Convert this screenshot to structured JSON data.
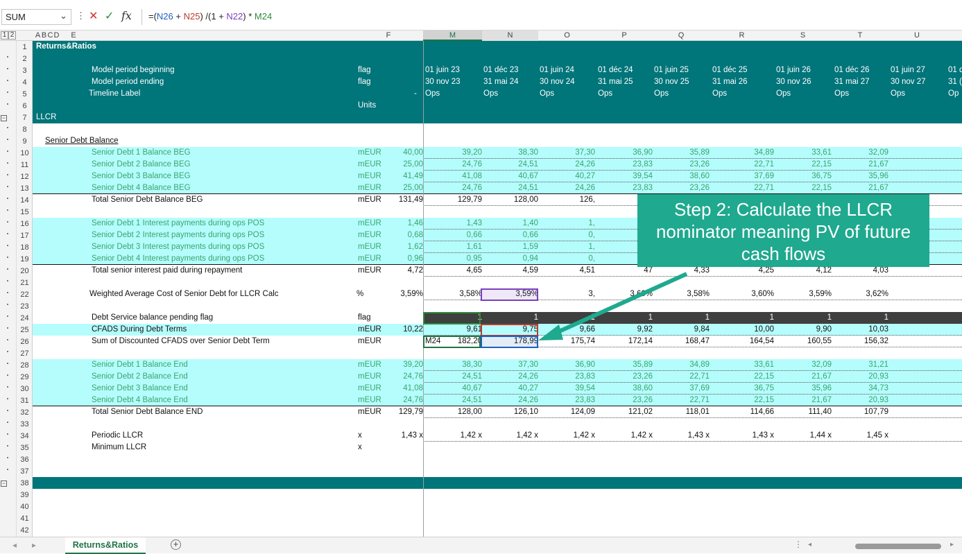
{
  "formula_bar": {
    "name_box": "SUM",
    "dots": "⋮",
    "cancel_icon": "✕",
    "enter_icon": "✓",
    "fx_label": "fx",
    "formula_parts": [
      {
        "t": "=(",
        "c": "#222"
      },
      {
        "t": "N26",
        "c": "#1f5fbf"
      },
      {
        "t": " + ",
        "c": "#222"
      },
      {
        "t": "N25",
        "c": "#c0392b"
      },
      {
        "t": ") /(1 + ",
        "c": "#222"
      },
      {
        "t": "N22",
        "c": "#7a3fbf"
      },
      {
        "t": ") * ",
        "c": "#222"
      },
      {
        "t": "M24",
        "c": "#2e8b3e"
      }
    ]
  },
  "outline_levels": [
    "1",
    "2"
  ],
  "columns": [
    "A",
    "B",
    "C",
    "D",
    "E",
    "F",
    "M",
    "N",
    "O",
    "P",
    "Q",
    "R",
    "S",
    "T",
    "U"
  ],
  "sheet_title": "Returns&Ratios",
  "header": {
    "periods_begin": [
      "01 juin 23",
      "01 déc 23",
      "01 juin 24",
      "01 déc 24",
      "01 juin 25",
      "01 déc 25",
      "01 juin 26",
      "01 déc 26",
      "01 juin 27",
      "01 d"
    ],
    "periods_end": [
      "30 nov 23",
      "31 mai 24",
      "30 nov 24",
      "31 mai 25",
      "30 nov 25",
      "31 mai 26",
      "30 nov 26",
      "31 mai 27",
      "30 nov 27",
      "31 ("
    ],
    "timeline": [
      "Ops",
      "Ops",
      "Ops",
      "Ops",
      "Ops",
      "Ops",
      "Ops",
      "Ops",
      "Ops",
      "Op"
    ]
  },
  "rows": [
    {
      "r": "1",
      "label": "Returns&Ratios",
      "bg": "teal",
      "bold": true,
      "indent": "a"
    },
    {
      "r": "2",
      "bg": "teal"
    },
    {
      "r": "3",
      "label": "Model period beginning",
      "unit": "flag",
      "bg": "teal",
      "hdr": "periods_begin"
    },
    {
      "r": "4",
      "label": "Model period ending",
      "unit": "flag",
      "bg": "teal",
      "hdr": "periods_end"
    },
    {
      "r": "5",
      "label": "Timeline Label",
      "unit": "-",
      "bg": "teal",
      "hdr": "timeline"
    },
    {
      "r": "6",
      "unit": "Units",
      "bg": "teal"
    },
    {
      "r": "7",
      "label": "LLCR",
      "bg": "teal",
      "indent": "a"
    },
    {
      "r": "8"
    },
    {
      "r": "9",
      "label": "Senior Debt Balance",
      "underline": true,
      "indent": "b"
    },
    {
      "r": "10",
      "label": "Senior Debt 1 Balance BEG",
      "unit": "mEUR",
      "bg": "cyan",
      "green": true,
      "v": [
        "40,00",
        "39,20",
        "38,30",
        "37,30",
        "36,90",
        "35,89",
        "34,89",
        "33,61",
        "32,09"
      ]
    },
    {
      "r": "11",
      "label": "Senior Debt 2 Balance BEG",
      "unit": "mEUR",
      "bg": "cyan",
      "green": true,
      "v": [
        "25,00",
        "24,76",
        "24,51",
        "24,26",
        "23,83",
        "23,26",
        "22,71",
        "22,15",
        "21,67"
      ]
    },
    {
      "r": "12",
      "label": "Senior Debt 3 Balance BEG",
      "unit": "mEUR",
      "bg": "cyan",
      "green": true,
      "v": [
        "41,49",
        "41,08",
        "40,67",
        "40,27",
        "39,54",
        "38,60",
        "37,69",
        "36,75",
        "35,96"
      ]
    },
    {
      "r": "13",
      "label": "Senior Debt 4 Balance BEG",
      "unit": "mEUR",
      "bg": "cyan",
      "green": true,
      "v": [
        "25,00",
        "24,76",
        "24,51",
        "24,26",
        "23,83",
        "23,26",
        "22,71",
        "22,15",
        "21,67"
      ]
    },
    {
      "r": "14",
      "label": "Total Senior Debt Balance BEG",
      "unit": "mEUR",
      "topline": true,
      "v": [
        "131,49",
        "129,79",
        "128,00",
        "126,",
        "",
        "",
        "",
        "",
        "40"
      ]
    },
    {
      "r": "15"
    },
    {
      "r": "16",
      "label": "Senior Debt 1 Interest payments during ops POS",
      "unit": "mEUR",
      "bg": "cyan",
      "green": true,
      "v": [
        "1,46",
        "1,43",
        "1,40",
        "1,",
        "",
        "",
        "",
        "",
        "17"
      ]
    },
    {
      "r": "17",
      "label": "Senior Debt 2 Interest payments during ops POS",
      "unit": "mEUR",
      "bg": "cyan",
      "green": true,
      "v": [
        "0,68",
        "0,66",
        "0,66",
        "0,",
        "",
        "",
        "",
        "",
        "62"
      ]
    },
    {
      "r": "18",
      "label": "Senior Debt 3 Interest payments during ops POS",
      "unit": "mEUR",
      "bg": "cyan",
      "green": true,
      "v": [
        "1,62",
        "1,61",
        "1,59",
        "1,",
        "",
        "",
        "",
        "",
        "41"
      ]
    },
    {
      "r": "19",
      "label": "Senior Debt 4 Interest payments during ops POS",
      "unit": "mEUR",
      "bg": "cyan",
      "green": true,
      "v": [
        "0,96",
        "0,95",
        "0,94",
        "0,",
        "",
        "",
        "",
        "",
        "83"
      ]
    },
    {
      "r": "20",
      "label": "Total senior interest paid during repayment",
      "unit": "mEUR",
      "topline": true,
      "v": [
        "4,72",
        "4,65",
        "4,59",
        "4,51",
        "47",
        "4,33",
        "4,25",
        "4,12",
        "4,03"
      ]
    },
    {
      "r": "21"
    },
    {
      "r": "22",
      "label": "Weighted Average Cost of Senior Debt for LLCR Calc",
      "unit": "%",
      "labelshift": true,
      "v": [
        "3,59%",
        "3,58%",
        "3,59%",
        "3,",
        "3,60%",
        "3,58%",
        "3,60%",
        "3,59%",
        "3,62%"
      ]
    },
    {
      "r": "23"
    },
    {
      "r": "24",
      "label": "Debt Service balance pending flag",
      "unit": "flag",
      "dark": true,
      "v": [
        "1",
        "1",
        "1",
        "1",
        "1",
        "1",
        "1",
        "1",
        "1"
      ]
    },
    {
      "r": "25",
      "label": "CFADS During Debt Terms",
      "unit": "mEUR",
      "bg": "cyan",
      "v": [
        "10,22",
        "9,61",
        "9,75",
        "9,66",
        "9,92",
        "9,84",
        "10,00",
        "9,90",
        "10,03"
      ]
    },
    {
      "r": "26",
      "label": "Sum of Discounted CFADS over Senior Debt Term",
      "unit": "mEUR",
      "v": [
        "M24",
        "182,20",
        "178,99",
        "175,74",
        "172,14",
        "168,47",
        "164,54",
        "160,55",
        "156,32"
      ]
    },
    {
      "r": "27"
    },
    {
      "r": "28",
      "label": "Senior Debt 1 Balance End",
      "unit": "mEUR",
      "bg": "cyan",
      "green": true,
      "v": [
        "39,20",
        "38,30",
        "37,30",
        "36,90",
        "35,89",
        "34,89",
        "33,61",
        "32,09",
        "31,21"
      ]
    },
    {
      "r": "29",
      "label": "Senior Debt 2 Balance End",
      "unit": "mEUR",
      "bg": "cyan",
      "green": true,
      "v": [
        "24,76",
        "24,51",
        "24,26",
        "23,83",
        "23,26",
        "22,71",
        "22,15",
        "21,67",
        "20,93"
      ]
    },
    {
      "r": "30",
      "label": "Senior Debt 3 Balance End",
      "unit": "mEUR",
      "bg": "cyan",
      "green": true,
      "v": [
        "41,08",
        "40,67",
        "40,27",
        "39,54",
        "38,60",
        "37,69",
        "36,75",
        "35,96",
        "34,73"
      ]
    },
    {
      "r": "31",
      "label": "Senior Debt 4 Balance End",
      "unit": "mEUR",
      "bg": "cyan",
      "green": true,
      "v": [
        "24,76",
        "24,51",
        "24,26",
        "23,83",
        "23,26",
        "22,71",
        "22,15",
        "21,67",
        "20,93"
      ]
    },
    {
      "r": "32",
      "label": "Total Senior Debt Balance END",
      "unit": "mEUR",
      "topline": true,
      "v": [
        "129,79",
        "128,00",
        "126,10",
        "124,09",
        "121,02",
        "118,01",
        "114,66",
        "111,40",
        "107,79"
      ]
    },
    {
      "r": "33"
    },
    {
      "r": "34",
      "label": "Periodic   LLCR",
      "unit": "x",
      "v": [
        "1,43 x",
        "1,42 x",
        "1,42 x",
        "1,42 x",
        "1,42 x",
        "1,43 x",
        "1,43 x",
        "1,44 x",
        "1,45 x"
      ]
    },
    {
      "r": "35",
      "label": "Minimum LLCR",
      "unit": "x"
    },
    {
      "r": "36"
    },
    {
      "r": "37"
    },
    {
      "r": "38",
      "bg": "teal"
    },
    {
      "r": "39"
    },
    {
      "r": "40"
    },
    {
      "r": "41"
    },
    {
      "r": "42"
    }
  ],
  "callout": {
    "text": "Step 2: Calculate the LLCR nominator meaning PV of future cash flows"
  },
  "sheet_tabs": {
    "active": "Returns&Ratios",
    "add": "+",
    "nav_prev": "◂",
    "nav_next": "▸",
    "more": "⋮"
  },
  "colors": {
    "teal": "#00757a",
    "cyan": "#b5fdfd",
    "dark": "#3f3f3f",
    "label_green": "#3aa56c",
    "callout": "#1fa98f"
  }
}
